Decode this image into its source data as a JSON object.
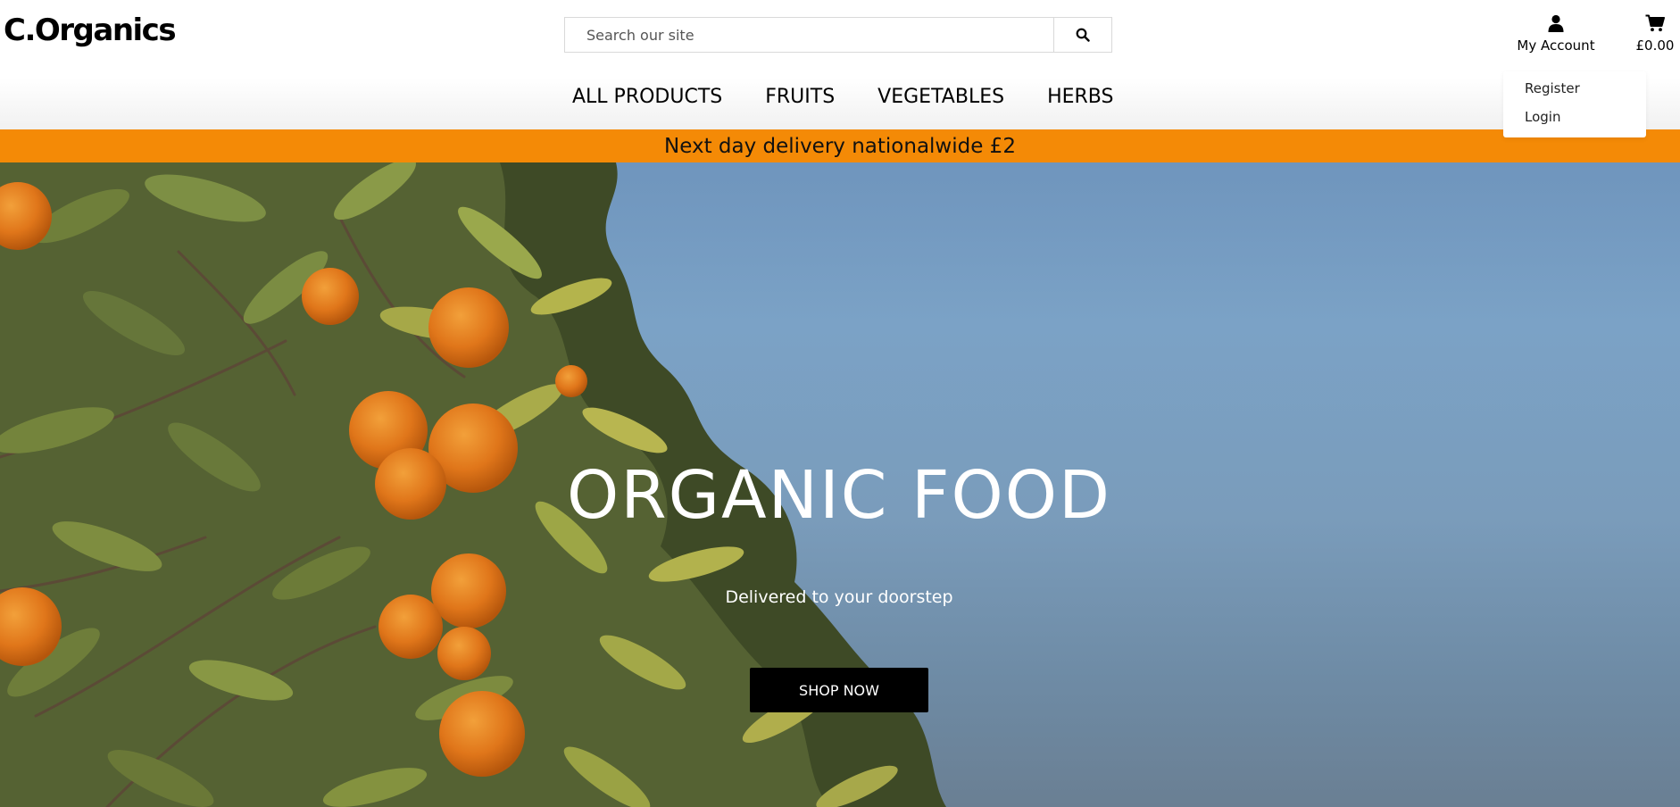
{
  "brand": {
    "logo": "C.Organics"
  },
  "search": {
    "placeholder": "Search our site",
    "icon": "search-icon"
  },
  "nav": {
    "items": [
      {
        "label": "ALL PRODUCTS"
      },
      {
        "label": "FRUITS"
      },
      {
        "label": "VEGETABLES"
      },
      {
        "label": "HERBS"
      }
    ]
  },
  "account": {
    "label": "My Account",
    "icon": "user-icon",
    "menu": [
      {
        "label": "Register"
      },
      {
        "label": "Login"
      }
    ]
  },
  "cart": {
    "total": "£0.00",
    "icon": "cart-icon"
  },
  "banner": {
    "text": "Next day delivery nationalwide £2",
    "color": "#f48a06"
  },
  "hero": {
    "title": "ORGANIC FOOD",
    "subtitle": "Delivered to your doorstep",
    "cta_label": "SHOP NOW",
    "image": "orange-tree-photo"
  }
}
